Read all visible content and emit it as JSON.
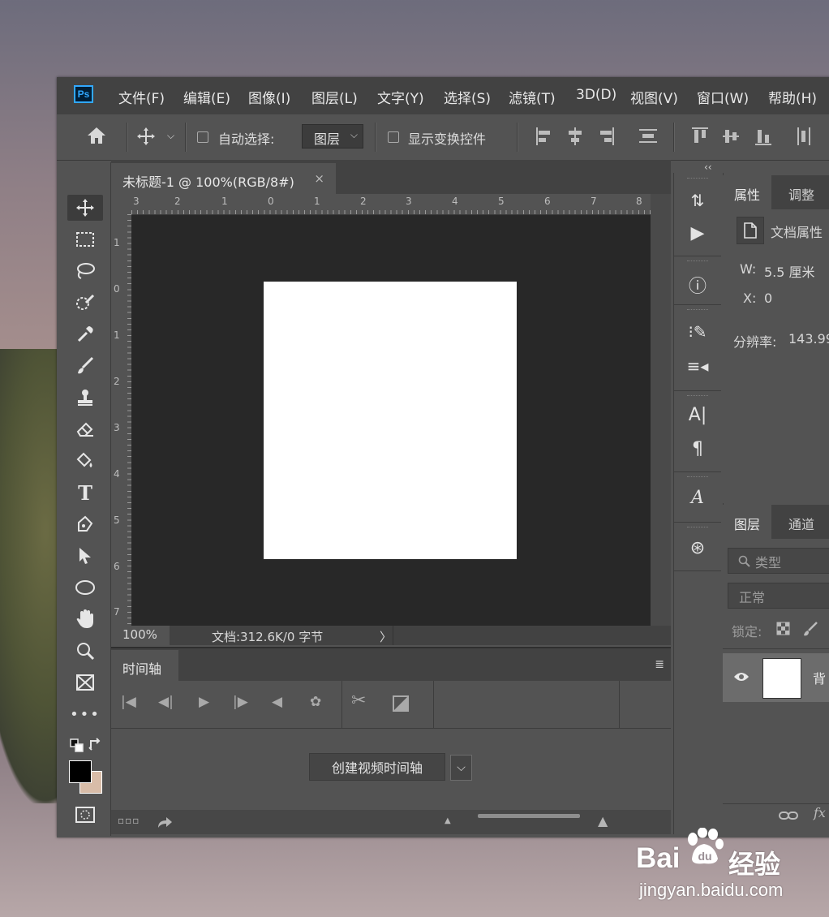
{
  "app": {
    "logo_text": "Ps",
    "menu": [
      "文件(F)",
      "编辑(E)",
      "图像(I)",
      "图层(L)",
      "文字(Y)",
      "选择(S)",
      "滤镜(T)",
      "3D(D)",
      "视图(V)",
      "窗口(W)",
      "帮助(H)"
    ]
  },
  "options": {
    "auto_select_label": "自动选择:",
    "auto_select_value": "图层",
    "show_transform_label": "显示变换控件"
  },
  "document": {
    "tab_title": "未标题-1 @ 100%(RGB/8#)",
    "close_glyph": "×",
    "ruler_top": [
      "3",
      "2",
      "1",
      "0",
      "1",
      "2",
      "3",
      "4",
      "5",
      "6",
      "7",
      "8"
    ],
    "ruler_left": [
      "1",
      "0",
      "1",
      "2",
      "3",
      "4",
      "5",
      "6",
      "7"
    ],
    "zoom": "100%",
    "doc_info": "文档:312.6K/0 字节",
    "status_arrow": "〉"
  },
  "timeline": {
    "tab": "时间轴",
    "create_button": "创建视频时间轴"
  },
  "properties": {
    "tabs": [
      "属性",
      "调整"
    ],
    "doc_props_label": "文档属性",
    "width_label": "W:",
    "width_value": "5.5 厘米",
    "x_label": "X:",
    "x_value": "0",
    "resolution_label": "分辨率:",
    "resolution_value": "143.99"
  },
  "layers": {
    "tabs": [
      "图层",
      "通道"
    ],
    "search_placeholder": "类型",
    "blend_mode": "正常",
    "lock_label": "锁定:",
    "layer_name": "背",
    "fx_label": "fx"
  },
  "watermark": {
    "brand_a": "Bai",
    "brand_b": "经验",
    "url": "jingyan.baidu.com"
  },
  "colors": {
    "foreground": "#000000",
    "background": "#d8bca8",
    "panel": "#535353",
    "canvas": "#282828"
  }
}
